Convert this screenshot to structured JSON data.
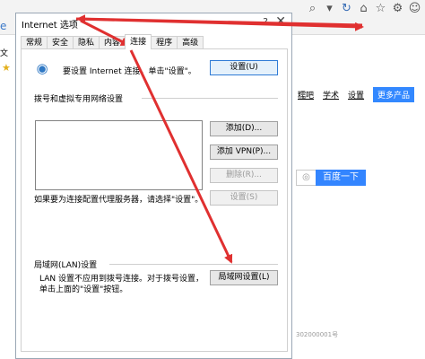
{
  "browser": {
    "menu_stub": "文",
    "nav": [
      "糯吧",
      "学术",
      "设置"
    ],
    "more_label": "更多产品",
    "search_button": "百度一下",
    "footer_stub": "302000001号"
  },
  "dialog": {
    "title": "Internet 选项",
    "help": "?",
    "close": "✕",
    "tabs": [
      "常规",
      "安全",
      "隐私",
      "内容",
      "连接",
      "程序",
      "高级"
    ],
    "active_tab": "连接",
    "setup_text": "要设置 Internet 连接，单击\"设置\"。",
    "setup_button": "设置(U)",
    "dialup_group": "拨号和虚拟专用网络设置",
    "add_button": "添加(D)...",
    "add_vpn_button": "添加 VPN(P)...",
    "delete_button": "删除(R)...",
    "settings_button": "设置(S)",
    "proxy_text": "如果要为连接配置代理服务器，请选择\"设置\"。",
    "lan_group": "局域网(LAN)设置",
    "lan_text": "LAN 设置不应用到拨号连接。对于拨号设置，单击上面的\"设置\"按钮。",
    "lan_button": "局域网设置(L)"
  },
  "colors": {
    "arrow": "#e03030",
    "accent": "#3385ff"
  }
}
